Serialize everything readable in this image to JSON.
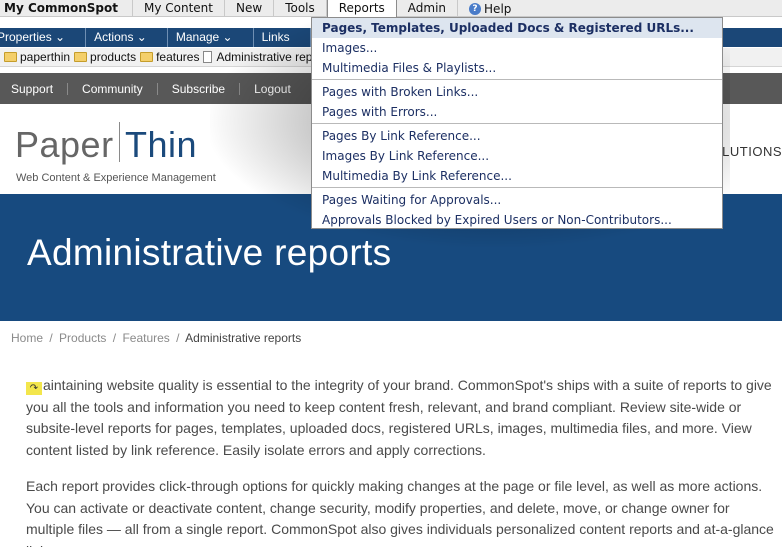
{
  "menubar": {
    "items": [
      "My CommonSpot",
      "My Content",
      "New",
      "Tools",
      "Reports",
      "Admin",
      "Help"
    ]
  },
  "toolbar": {
    "items": [
      "Properties ⌄",
      "Actions ⌄",
      "Manage ⌄",
      "Links"
    ]
  },
  "path": {
    "crumbs": [
      "paperthin",
      "products",
      "features",
      "Administrative reports"
    ]
  },
  "site_nav": {
    "items": [
      "Support",
      "Community",
      "Subscribe",
      "Logout"
    ]
  },
  "logo": {
    "paper": "Paper",
    "thin": "Thin",
    "tagline": "Web Content & Experience Management",
    "solutions": "SOLUTIONS"
  },
  "hero": {
    "title": "Administrative reports"
  },
  "breadcrumb": {
    "home": "Home",
    "products": "Products",
    "features": "Features",
    "current": "Administrative reports",
    "sep": "/"
  },
  "content": {
    "p1_flag": "↷",
    "p1": "aintaining website quality is essential to the integrity of your brand. CommonSpot's ships with a suite of reports to give you all the tools and information you need to keep content fresh, relevant, and brand compliant. Review site-wide or subsite-level reports for pages, templates, uploaded docs, registered URLs, images, multimedia files, and more. View content listed by link reference. Easily isolate errors and apply corrections.",
    "p2": "Each report provides click-through options for quickly making changes at the page or file level, as well as more actions. You can activate or deactivate content, change security, modify properties, and delete, move, or change owner for multiple files — all from a single report. CommonSpot also gives individuals personalized content reports and at-a-glance link,"
  },
  "reports_menu": {
    "group1": [
      "Pages, Templates, Uploaded Docs & Registered URLs...",
      "Images...",
      "Multimedia Files & Playlists..."
    ],
    "group2": [
      "Pages with Broken Links...",
      "Pages with Errors..."
    ],
    "group3": [
      "Pages By Link Reference...",
      "Images By Link Reference...",
      "Multimedia By Link Reference..."
    ],
    "group4": [
      "Pages Waiting for Approvals...",
      "Approvals Blocked by Expired Users or Non-Contributors..."
    ]
  },
  "colors": {
    "toolbar_blue": "#1b4777",
    "hero_blue": "#174a7f",
    "menu_text": "#1c2f63",
    "menu_highlight": "#dde5ef"
  }
}
